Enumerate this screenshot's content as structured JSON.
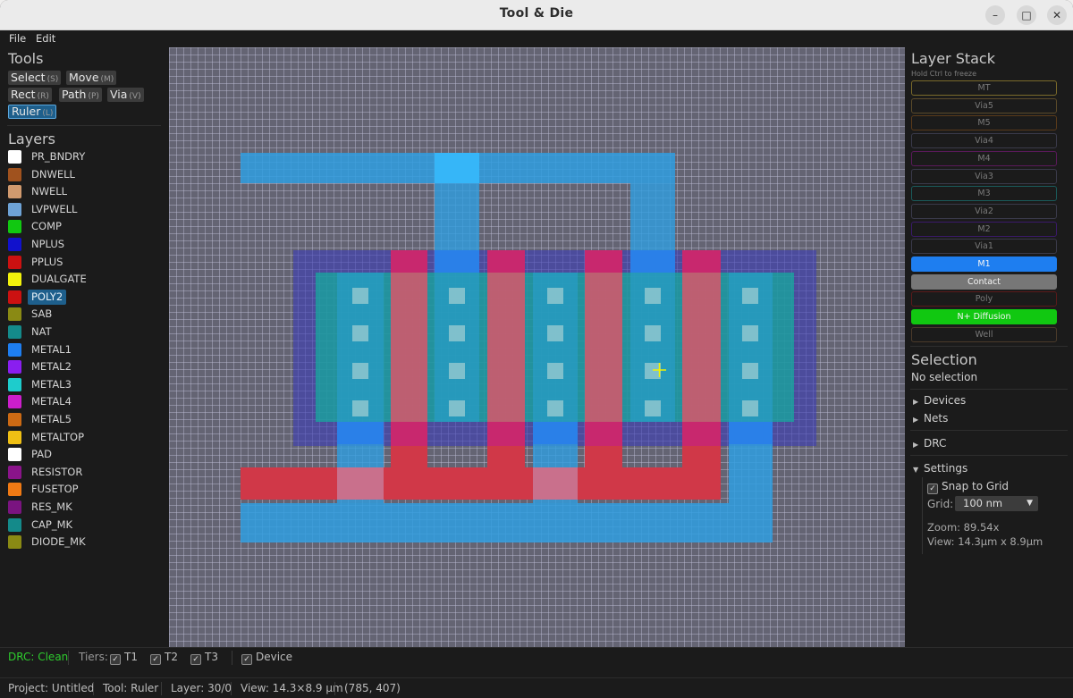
{
  "window": {
    "title": "Tool & Die"
  },
  "menu": {
    "file": "File",
    "edit": "Edit"
  },
  "tools": {
    "header": "Tools",
    "items": [
      {
        "label": "Select",
        "key": "(S)"
      },
      {
        "label": "Move",
        "key": "(M)"
      },
      {
        "label": "Rect",
        "key": "(R)"
      },
      {
        "label": "Path",
        "key": "(P)"
      },
      {
        "label": "Via",
        "key": "(V)"
      },
      {
        "label": "Ruler",
        "key": "(L)"
      }
    ],
    "active": "Ruler"
  },
  "layers": {
    "header": "Layers",
    "selected": "POLY2",
    "items": [
      {
        "name": "PR_BNDRY",
        "color": "#ffffff"
      },
      {
        "name": "DNWELL",
        "color": "#a0521e"
      },
      {
        "name": "NWELL",
        "color": "#d19a6e"
      },
      {
        "name": "LVPWELL",
        "color": "#6ea3d6"
      },
      {
        "name": "COMP",
        "color": "#11c811"
      },
      {
        "name": "NPLUS",
        "color": "#1111cc"
      },
      {
        "name": "PPLUS",
        "color": "#cc1111"
      },
      {
        "name": "DUALGATE",
        "color": "#f2f20c"
      },
      {
        "name": "POLY2",
        "color": "#cc1111"
      },
      {
        "name": "SAB",
        "color": "#8a8a14"
      },
      {
        "name": "NAT",
        "color": "#148a8a"
      },
      {
        "name": "METAL1",
        "color": "#1e7ef0"
      },
      {
        "name": "METAL2",
        "color": "#8a1ef0"
      },
      {
        "name": "METAL3",
        "color": "#1ecccc"
      },
      {
        "name": "METAL4",
        "color": "#cc1ecc"
      },
      {
        "name": "METAL5",
        "color": "#cc6a14"
      },
      {
        "name": "METALTOP",
        "color": "#f0c014"
      },
      {
        "name": "PAD",
        "color": "#ffffff"
      },
      {
        "name": "RESISTOR",
        "color": "#8a148a"
      },
      {
        "name": "FUSETOP",
        "color": "#f07a14"
      },
      {
        "name": "RES_MK",
        "color": "#7a1480"
      },
      {
        "name": "CAP_MK",
        "color": "#148a8a"
      },
      {
        "name": "DIODE_MK",
        "color": "#8a8a14"
      }
    ]
  },
  "layer_stack": {
    "header": "Layer Stack",
    "hint": "Hold Ctrl to freeze",
    "items": [
      {
        "label": "MT",
        "border": "#7a6a2a",
        "active": false
      },
      {
        "label": "Via5",
        "border": "#5a4a2a",
        "active": false
      },
      {
        "label": "M5",
        "border": "#5a3a1a",
        "active": false
      },
      {
        "label": "Via4",
        "border": "#3a3a4a",
        "active": false
      },
      {
        "label": "M4",
        "border": "#5a1a5a",
        "active": false
      },
      {
        "label": "Via3",
        "border": "#3a3a4a",
        "active": false
      },
      {
        "label": "M3",
        "border": "#1a5a5a",
        "active": false
      },
      {
        "label": "Via2",
        "border": "#3a3a4a",
        "active": false
      },
      {
        "label": "M2",
        "border": "#3a1a6a",
        "active": false
      },
      {
        "label": "Via1",
        "border": "#3a3a4a",
        "active": false
      },
      {
        "label": "M1",
        "border": "#1e7ef0",
        "fill": "#1e7ef0",
        "active": true
      },
      {
        "label": "Contact",
        "border": "#777777",
        "fill": "#777777",
        "active": true
      },
      {
        "label": "Poly",
        "border": "#5a1a1a",
        "active": false
      },
      {
        "label": "N+ Diffusion",
        "border": "#11c811",
        "fill": "#11c811",
        "active": true
      },
      {
        "label": "Well",
        "border": "#4a3a2a",
        "active": false
      }
    ]
  },
  "selection": {
    "header": "Selection",
    "value": "No selection"
  },
  "sections": {
    "devices": "Devices",
    "nets": "Nets",
    "drc": "DRC",
    "settings": "Settings"
  },
  "settings": {
    "snap_label": "Snap to Grid",
    "snap_checked": true,
    "grid_label": "Grid:",
    "grid_value": "100 nm",
    "zoom": "Zoom: 89.54x",
    "view": "View: 14.3μm x 8.9μm"
  },
  "status_top": {
    "drc": "DRC: Clean",
    "tiers_label": "Tiers:",
    "tiers": [
      "T1",
      "T2",
      "T3"
    ],
    "device": "Device"
  },
  "status_bottom": {
    "project": "Project: Untitled",
    "tool": "Tool: Ruler",
    "layer": "Layer: 30/0",
    "view": "View: 14.3×8.9 μm",
    "cursor": "(785, 407)"
  },
  "colors": {
    "drc_ok": "#2ecc2e",
    "accent": "#1e5f8c"
  }
}
